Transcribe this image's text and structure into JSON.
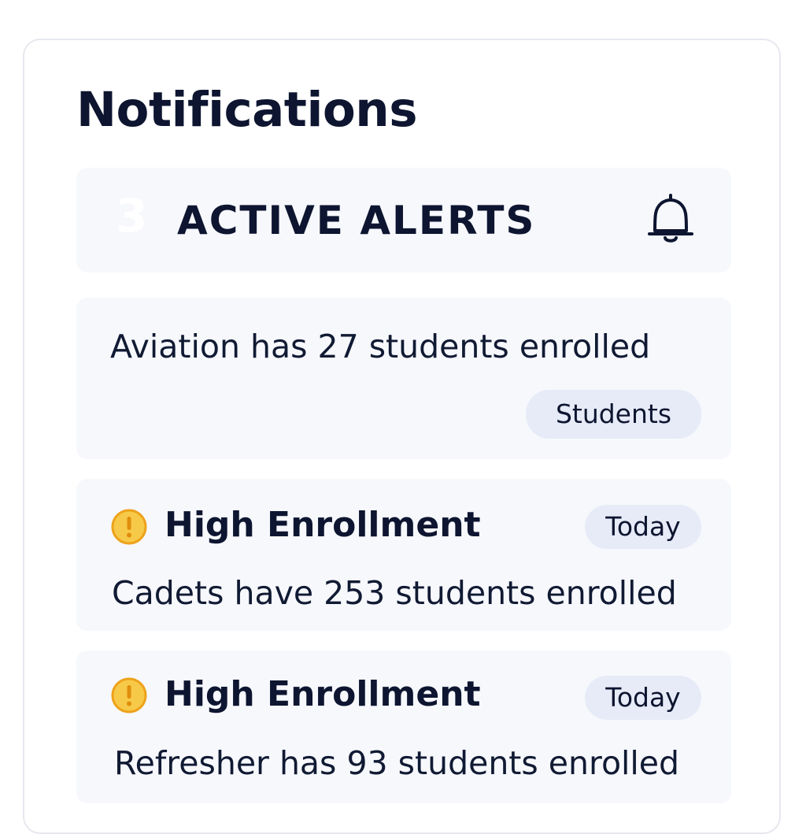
{
  "header": {
    "title": "Notifications"
  },
  "summary": {
    "count": "3",
    "label": "ACTIVE ALERTS",
    "icon": "bell-icon"
  },
  "notifications": [
    {
      "message": "Aviation has 27 students enrolled",
      "tag": "Students"
    },
    {
      "title": "High Enrollment",
      "tag": "Today",
      "message": "Cadets have 253 students enrolled",
      "icon": "warning-icon",
      "icon_color": "#f5b82e"
    },
    {
      "title": "High Enrollment",
      "tag": "Today",
      "message": "Refresher has 93 students enrolled",
      "icon": "warning-icon",
      "icon_color": "#f5b82e"
    }
  ],
  "colors": {
    "text_primary": "#0d1530",
    "card_bg": "#f6f8fc",
    "tag_bg": "#e6ebf7",
    "warning": "#f5b82e"
  }
}
